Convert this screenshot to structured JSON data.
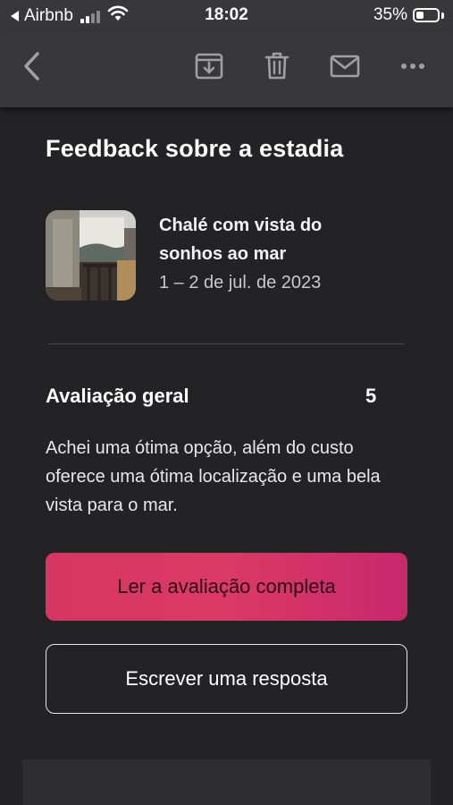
{
  "status_bar": {
    "carrier": "Airbnb",
    "time": "18:02",
    "battery_percent": "35%",
    "battery_level": 0.35,
    "signal_bars_active": 2,
    "signal_bars_total": 4
  },
  "toolbar": {
    "icons": [
      "back-chevron-icon",
      "archive-icon",
      "trash-icon",
      "mail-icon",
      "more-icon"
    ]
  },
  "email": {
    "title": "Feedback sobre a estadia",
    "listing": {
      "name": "Chalé com vista do sonhos ao mar",
      "dates": "1 – 2 de jul. de 2023"
    },
    "rating": {
      "label": "Avaliação geral",
      "value": "5"
    },
    "review_text": "Achei uma ótima opção, além do custo oferece uma ótima localização e uma bela vista para o mar.",
    "primary_button": "Ler a avaliação completa",
    "secondary_button": "Escrever uma resposta"
  },
  "colors": {
    "background": "#232326",
    "toolbar": "#38383b",
    "accent": "#d63662",
    "icon": "#a0a0a4"
  }
}
